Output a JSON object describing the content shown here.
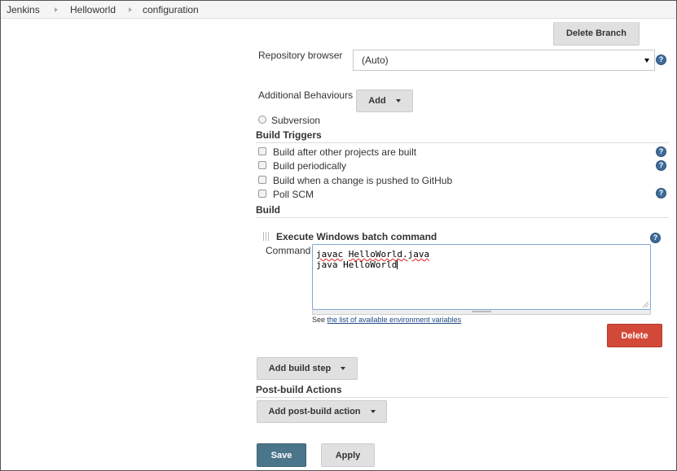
{
  "breadcrumb": {
    "items": [
      "Jenkins",
      "Helloworld",
      "configuration"
    ]
  },
  "scm": {
    "delete_branch_label": "Delete Branch",
    "repo_browser_label": "Repository browser",
    "repo_browser_value": "(Auto)",
    "additional_behaviours_label": "Additional Behaviours",
    "add_label": "Add",
    "subversion_label": "Subversion"
  },
  "build_triggers": {
    "title": "Build Triggers",
    "items": [
      {
        "label": "Build after other projects are built",
        "checked": false,
        "help": true
      },
      {
        "label": "Build periodically",
        "checked": false,
        "help": true
      },
      {
        "label": "Build when a change is pushed to GitHub",
        "checked": false,
        "help": false
      },
      {
        "label": "Poll SCM",
        "checked": false,
        "help": true
      }
    ]
  },
  "build": {
    "title": "Build",
    "step_title": "Execute Windows batch command",
    "command_label": "Command",
    "command_line1_word1": "javac",
    "command_line1_word2": "HelloWorld.java",
    "command_line2": "java HelloWorld",
    "see_prefix": "See ",
    "env_link": "the list of available environment variables",
    "delete_label": "Delete",
    "add_build_step_label": "Add build step"
  },
  "post_build": {
    "title": "Post-build Actions",
    "add_label": "Add post-build action"
  },
  "footer": {
    "save_label": "Save",
    "apply_label": "Apply"
  },
  "colors": {
    "delete_button": "#d24939",
    "save_button": "#4b758b",
    "help_icon": "#3d6c9a"
  },
  "icons": [
    "help-icon",
    "chevron-right-icon",
    "caret-down-icon",
    "drag-handle-icon",
    "resize-grip-icon"
  ]
}
